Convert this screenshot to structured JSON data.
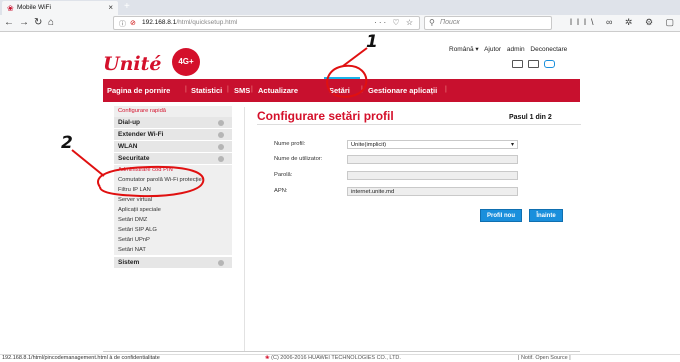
{
  "browser": {
    "tab_title": "Mobile WiFi",
    "tab_close": "×",
    "new_tab": "+",
    "url_host": "192.168.8.1",
    "url_path": "/html/quicksetup.html",
    "url_actions": "··· ♡ ☆",
    "search_placeholder": "Поиск",
    "toolbar_icons": "lll\\ ∞ ✲ ⚙ ▢ » ≡",
    "nav_back": "←",
    "nav_forward": "→",
    "nav_reload": "↻",
    "nav_home": "⌂",
    "status_url": "192.168.8.1/html/pincodemanagement.html à de confidentialitate"
  },
  "header": {
    "logo_text": "Unité",
    "logo_badge": "4G+",
    "language": "Română ▾",
    "help": "Ajutor",
    "admin": "admin",
    "logout": "Deconectare"
  },
  "main_nav": {
    "items": [
      "Pagina de pornire",
      "Statistici",
      "SMS",
      "Actualizare",
      "Setări",
      "Gestionare aplicații"
    ],
    "active_index": 4,
    "accent_color": "#c8102e",
    "active_color": "#1ab2e8"
  },
  "sidebar": {
    "quick_setup": "Configurare rapidă",
    "groups": [
      {
        "label": "Dial-up",
        "collapsed": true
      },
      {
        "label": "Extender Wi-Fi",
        "collapsed": true
      },
      {
        "label": "WLAN",
        "collapsed": true
      },
      {
        "label": "Securitate",
        "collapsed": false
      }
    ],
    "security_items": [
      "Administrare cod PIN",
      "Comutator parolă Wi-Fi protecție",
      "Filtru IP LAN",
      "Server virtual",
      "Aplicații speciale",
      "Setări DMZ",
      "Setări SIP ALG",
      "Setări UPnP",
      "Setări NAT"
    ],
    "system": "Sistem"
  },
  "content": {
    "title": "Configurare setări profil",
    "step": "Pasul 1 din 2",
    "fields": [
      {
        "label": "Nume profil:",
        "value": "Unite(implicit)"
      },
      {
        "label": "Nume de utilizator:",
        "value": ""
      },
      {
        "label": "Parolă:",
        "value": ""
      },
      {
        "label": "APN:",
        "value": "internet.unite.md"
      }
    ],
    "btn_new_profile": "Profil nou",
    "btn_next": "Înainte"
  },
  "annotations": {
    "one": "1",
    "two": "2"
  },
  "footer": {
    "copyright": "(C) 2006-2016 HUAWEI TECHNOLOGIES CO., LTD.",
    "links": "| Notif. Open Source |"
  }
}
